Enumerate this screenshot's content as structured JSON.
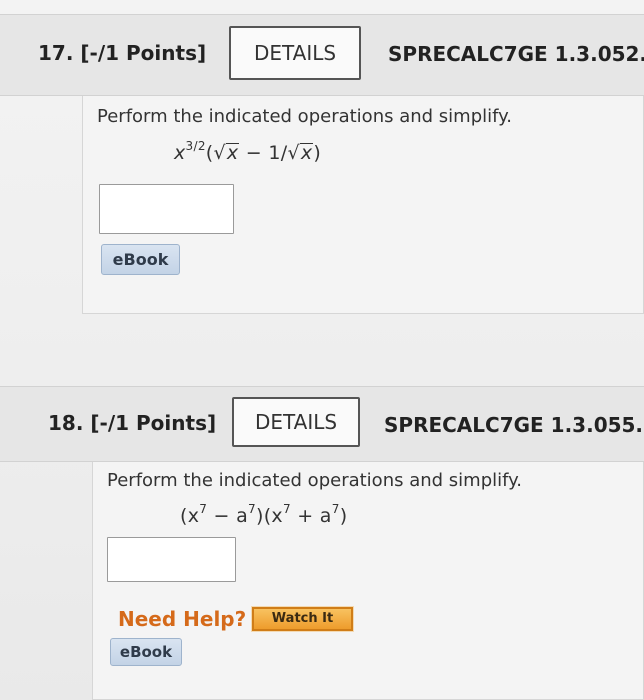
{
  "questions": [
    {
      "number": "17. [-/1 Points]",
      "details_label": "DETAILS",
      "code": "SPRECALC7GE 1.3.052.",
      "prompt": "Perform the indicated operations and simplify.",
      "expression": {
        "base": "x",
        "exponent": "3/2",
        "open": "(",
        "radical_1": "x",
        "minus": " − 1/",
        "radical_2": "x",
        "close": ")"
      },
      "ebook_label": "eBook"
    },
    {
      "number": "18. [-/1 Points]",
      "details_label": "DETAILS",
      "code": "SPRECALC7GE 1.3.055.",
      "prompt": "Perform the indicated operations and simplify.",
      "expression": {
        "open_1": "(x",
        "exp_1": "7",
        "minus": " − a",
        "exp_2": "7",
        "close_open": ")(x",
        "exp_3": "7",
        "plus": " + a",
        "exp_4": "7",
        "close": ")"
      },
      "help_label": "Need Help?",
      "watch_label": "Watch It",
      "ebook_label": "eBook"
    }
  ],
  "colors": {
    "need_help": "#d56a1a",
    "watch_button": "#ee9c2c",
    "ebook_button": "#c3d3e6"
  }
}
